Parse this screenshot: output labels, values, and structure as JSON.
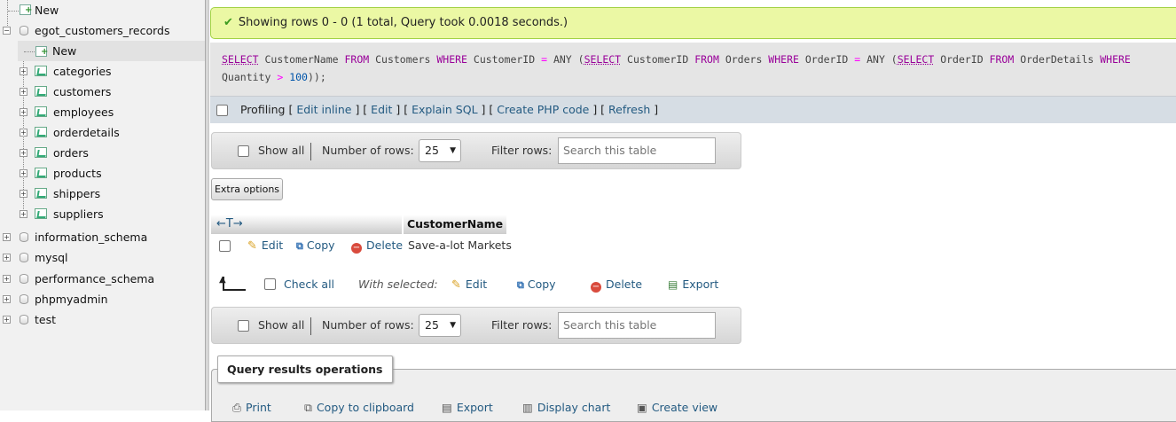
{
  "sidebar": {
    "top_new": "New",
    "databases": [
      {
        "name": "egot_customers_records",
        "expanded": true
      },
      {
        "name": "information_schema"
      },
      {
        "name": "mysql"
      },
      {
        "name": "performance_schema"
      },
      {
        "name": "phpmyadmin"
      },
      {
        "name": "test"
      }
    ],
    "db_new": "New",
    "tables": [
      "categories",
      "customers",
      "employees",
      "orderdetails",
      "orders",
      "products",
      "shippers",
      "suppliers"
    ]
  },
  "message": {
    "text": "Showing rows 0 - 0 (1 total, Query took 0.0018 seconds.)"
  },
  "sql": {
    "line1": [
      {
        "t": "SELECT",
        "c": "kwu"
      },
      {
        "t": " CustomerName ",
        "c": ""
      },
      {
        "t": "FROM",
        "c": "kw"
      },
      {
        "t": " Customers ",
        "c": ""
      },
      {
        "t": "WHERE",
        "c": "kw"
      },
      {
        "t": " CustomerID ",
        "c": ""
      },
      {
        "t": "=",
        "c": "op"
      },
      {
        "t": " ANY (",
        "c": ""
      },
      {
        "t": "SELECT",
        "c": "kwu"
      },
      {
        "t": " CustomerID ",
        "c": ""
      },
      {
        "t": "FROM",
        "c": "kw"
      },
      {
        "t": " Orders ",
        "c": ""
      },
      {
        "t": "WHERE",
        "c": "kw"
      },
      {
        "t": " OrderID ",
        "c": ""
      },
      {
        "t": "=",
        "c": "op"
      },
      {
        "t": " ANY (",
        "c": ""
      },
      {
        "t": "SELECT",
        "c": "kwu"
      },
      {
        "t": " OrderID ",
        "c": ""
      },
      {
        "t": "FROM",
        "c": "kw"
      },
      {
        "t": " OrderDetails ",
        "c": ""
      },
      {
        "t": "WHERE",
        "c": "kw"
      }
    ],
    "line2": [
      {
        "t": "Quantity ",
        "c": ""
      },
      {
        "t": ">",
        "c": "op"
      },
      {
        "t": " ",
        "c": ""
      },
      {
        "t": "100",
        "c": "num"
      },
      {
        "t": "));",
        "c": ""
      }
    ]
  },
  "profiling": {
    "label": "Profiling",
    "links": [
      "Edit inline",
      "Edit",
      "Explain SQL",
      "Create PHP code",
      "Refresh"
    ]
  },
  "navbar": {
    "show_all": "Show all",
    "rows_label": "Number of rows:",
    "rows_value": "25",
    "filter_label": "Filter rows:",
    "search_placeholder": "Search this table"
  },
  "extra_options": "Extra options",
  "results": {
    "column": "CustomerName",
    "rows": [
      {
        "edit": "Edit",
        "copy": "Copy",
        "delete": "Delete",
        "value": "Save-a-lot Markets"
      }
    ]
  },
  "bulk": {
    "check_all": "Check all",
    "with_selected": "With selected:",
    "edit": "Edit",
    "copy": "Copy",
    "delete": "Delete",
    "export": "Export"
  },
  "operations": {
    "title": "Query results operations",
    "items": [
      "Print",
      "Copy to clipboard",
      "Export",
      "Display chart",
      "Create view"
    ]
  }
}
